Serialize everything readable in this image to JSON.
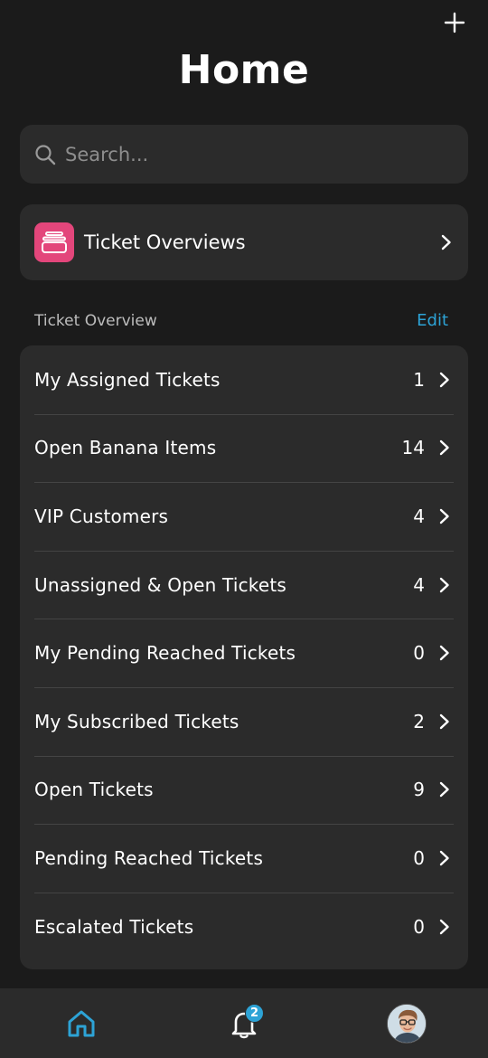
{
  "header": {
    "title": "Home",
    "add_icon": "plus-icon"
  },
  "search": {
    "placeholder": "Search...",
    "icon": "search-icon"
  },
  "overview_card": {
    "label": "Ticket Overviews",
    "icon": "stacked-cards-icon",
    "icon_color": "#e3467b"
  },
  "section": {
    "title": "Ticket Overview",
    "edit_label": "Edit",
    "accent_color": "#2da3d6"
  },
  "ticket_list": [
    {
      "label": "My Assigned Tickets",
      "count": "1"
    },
    {
      "label": "Open Banana Items",
      "count": "14"
    },
    {
      "label": "VIP Customers",
      "count": "4"
    },
    {
      "label": "Unassigned & Open Tickets",
      "count": "4"
    },
    {
      "label": "My Pending Reached Tickets",
      "count": "0"
    },
    {
      "label": "My Subscribed Tickets",
      "count": "2"
    },
    {
      "label": "Open Tickets",
      "count": "9"
    },
    {
      "label": "Pending Reached Tickets",
      "count": "0"
    },
    {
      "label": "Escalated Tickets",
      "count": "0"
    }
  ],
  "tab_bar": {
    "home_icon": "home-icon",
    "bell_icon": "bell-icon",
    "notification_count": "2",
    "profile_icon": "avatar"
  }
}
